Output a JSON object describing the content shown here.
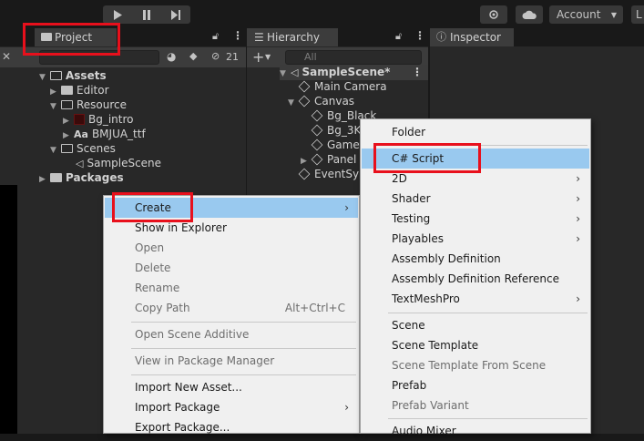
{
  "toolbar": {
    "play_icon": "play-icon",
    "pause_icon": "pause-icon",
    "step_icon": "step-icon",
    "account_label": "Account",
    "layout_label": "L"
  },
  "project_panel": {
    "tab_label": "Project",
    "search_count": "21",
    "tree": [
      {
        "label": "Assets",
        "bold": true
      },
      {
        "label": "Editor"
      },
      {
        "label": "Resource"
      },
      {
        "label": "Bg_intro"
      },
      {
        "label": "BMJUA_ttf",
        "prefix": "Aa"
      },
      {
        "label": "Scenes"
      },
      {
        "label": "SampleScene"
      },
      {
        "label": "Packages",
        "bold": true
      }
    ]
  },
  "hierarchy_panel": {
    "tab_label": "Hierarchy",
    "search_placeholder": "All",
    "tree": [
      {
        "label": "SampleScene*"
      },
      {
        "label": "Main Camera"
      },
      {
        "label": "Canvas"
      },
      {
        "label": "Bg_Black"
      },
      {
        "label": "Bg_3K"
      },
      {
        "label": "Game"
      },
      {
        "label": "Panel"
      },
      {
        "label": "EventSy"
      }
    ]
  },
  "inspector_panel": {
    "tab_label": "Inspector"
  },
  "context_menu": {
    "items": [
      {
        "label": "Create",
        "submenu": true,
        "highlighted": true
      },
      {
        "label": "Show in Explorer"
      },
      {
        "label": "Open",
        "disabled": true
      },
      {
        "label": "Delete",
        "disabled": true
      },
      {
        "label": "Rename",
        "disabled": true
      },
      {
        "label": "Copy Path",
        "disabled": true,
        "shortcut": "Alt+Ctrl+C"
      },
      {
        "label": "Open Scene Additive",
        "disabled": true
      },
      {
        "label": "View in Package Manager",
        "disabled": true
      },
      {
        "label": "Import New Asset..."
      },
      {
        "label": "Import Package",
        "submenu": true
      },
      {
        "label": "Export Package..."
      }
    ]
  },
  "create_submenu": {
    "items": [
      {
        "label": "Folder"
      },
      {
        "label": "C# Script",
        "highlighted": true
      },
      {
        "label": "2D",
        "submenu": true
      },
      {
        "label": "Shader",
        "submenu": true
      },
      {
        "label": "Testing",
        "submenu": true
      },
      {
        "label": "Playables",
        "submenu": true
      },
      {
        "label": "Assembly Definition"
      },
      {
        "label": "Assembly Definition Reference"
      },
      {
        "label": "TextMeshPro",
        "submenu": true
      },
      {
        "label": "Scene"
      },
      {
        "label": "Scene Template"
      },
      {
        "label": "Scene Template From Scene",
        "disabled": true
      },
      {
        "label": "Prefab"
      },
      {
        "label": "Prefab Variant",
        "disabled": true
      },
      {
        "label": "Audio Mixer"
      }
    ]
  },
  "highlight_color": "#e8101c"
}
